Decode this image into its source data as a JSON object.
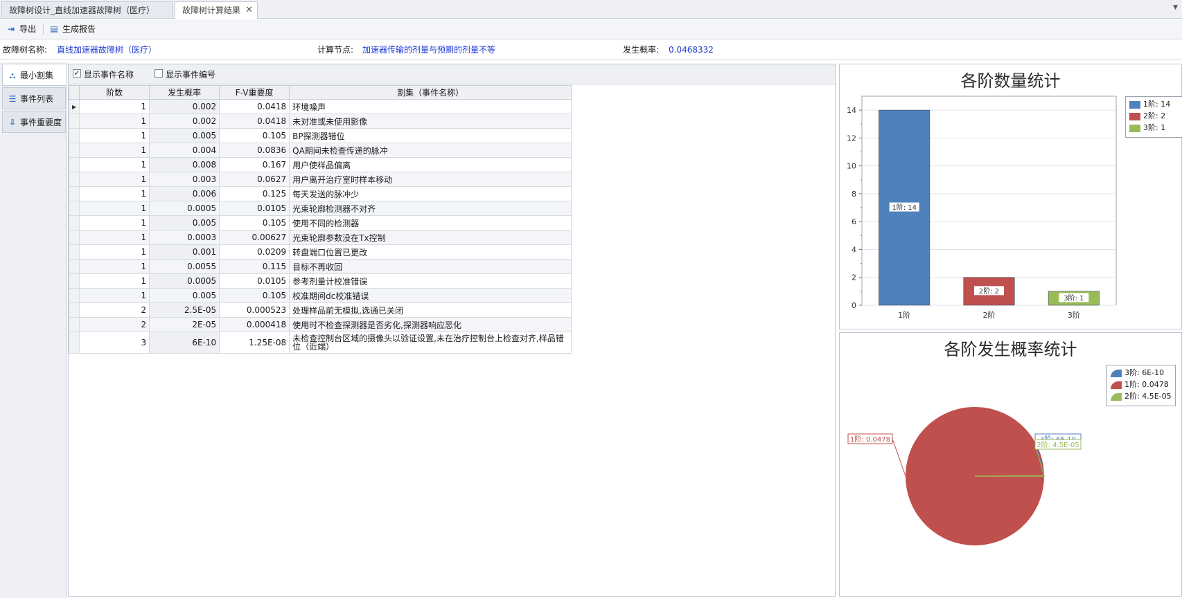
{
  "tabs": [
    {
      "label": "故障树设计_直线加速器故障树（医疗）",
      "active": false
    },
    {
      "label": "故障树计算结果",
      "active": true
    }
  ],
  "toolbar": {
    "export_label": "导出",
    "report_label": "生成报告"
  },
  "info": {
    "tree_name_label": "故障树名称:",
    "tree_name_value": "直线加速器故障树（医疗）",
    "node_label": "计算节点:",
    "node_value": "加速器传输的剂量与预期的剂量不等",
    "prob_label": "发生概率:",
    "prob_value": "0.0468332"
  },
  "side_tabs": [
    "最小割集",
    "事件列表",
    "事件重要度"
  ],
  "grid_options": {
    "show_name_label": "显示事件名称",
    "show_name_checked": true,
    "show_id_label": "显示事件编号",
    "show_id_checked": false
  },
  "columns": [
    "阶数",
    "发生概率",
    "F-V重要度",
    "割集（事件名称）"
  ],
  "rows": [
    [
      "1",
      "0.002",
      "0.0418",
      "环境噪声"
    ],
    [
      "1",
      "0.002",
      "0.0418",
      "未对准或未使用影像"
    ],
    [
      "1",
      "0.005",
      "0.105",
      "BP探测器错位"
    ],
    [
      "1",
      "0.004",
      "0.0836",
      "QA期间未检查传递的脉冲"
    ],
    [
      "1",
      "0.008",
      "0.167",
      "用户使样品偏离"
    ],
    [
      "1",
      "0.003",
      "0.0627",
      "用户离开治疗室时样本移动"
    ],
    [
      "1",
      "0.006",
      "0.125",
      "每天发送的脉冲少"
    ],
    [
      "1",
      "0.0005",
      "0.0105",
      "光束轮廓检测器不对齐"
    ],
    [
      "1",
      "0.005",
      "0.105",
      "使用不同的检测器"
    ],
    [
      "1",
      "0.0003",
      "0.00627",
      "光束轮廓参数没在Tx控制"
    ],
    [
      "1",
      "0.001",
      "0.0209",
      "转盘端口位置已更改"
    ],
    [
      "1",
      "0.0055",
      "0.115",
      "目标不再收回"
    ],
    [
      "1",
      "0.0005",
      "0.0105",
      "参考剂量计校准错误"
    ],
    [
      "1",
      "0.005",
      "0.105",
      "校准期间dc校准错误"
    ],
    [
      "2",
      "2.5E-05",
      "0.000523",
      "处理样品前无模拟,选通已关闭"
    ],
    [
      "2",
      "2E-05",
      "0.000418",
      "使用时不检查探测器是否劣化,探测器响应恶化"
    ],
    [
      "3",
      "6E-10",
      "1.25E-08",
      "未检查控制台区域的摄像头以验证设置,未在治疗控制台上检查对齐,样品错位（近端）"
    ]
  ],
  "colors": {
    "order1_blue": "#4f81bd",
    "order2_red": "#c0504d",
    "order3_green": "#9bbb59",
    "link_blue": "#1f3bd6"
  },
  "chart_data": [
    {
      "type": "bar",
      "title": "各阶数量统计",
      "categories": [
        "1阶",
        "2阶",
        "3阶"
      ],
      "values": [
        14,
        2,
        1
      ],
      "data_labels": [
        "1阶: 14",
        "2阶: 2",
        "3阶: 1"
      ],
      "yticks": [
        "0",
        "2",
        "4",
        "6",
        "8",
        "10",
        "12",
        "14"
      ],
      "ylim": [
        0,
        15
      ],
      "legend": [
        "1阶: 14",
        "2阶: 2",
        "3阶: 1"
      ],
      "legend_position": "top-right",
      "grid": true
    },
    {
      "type": "pie",
      "title": "各阶发生概率统计",
      "labels": [
        "3阶",
        "1阶",
        "2阶"
      ],
      "values": [
        6e-10,
        0.0478,
        4.5e-05
      ],
      "data_labels": [
        "3阶: 6E-10",
        "1阶: 0.0478",
        "2阶: 4.5E-05"
      ],
      "legend": [
        "3阶: 6E-10",
        "1阶: 0.0478",
        "2阶: 4.5E-05"
      ],
      "legend_position": "top-right"
    }
  ]
}
